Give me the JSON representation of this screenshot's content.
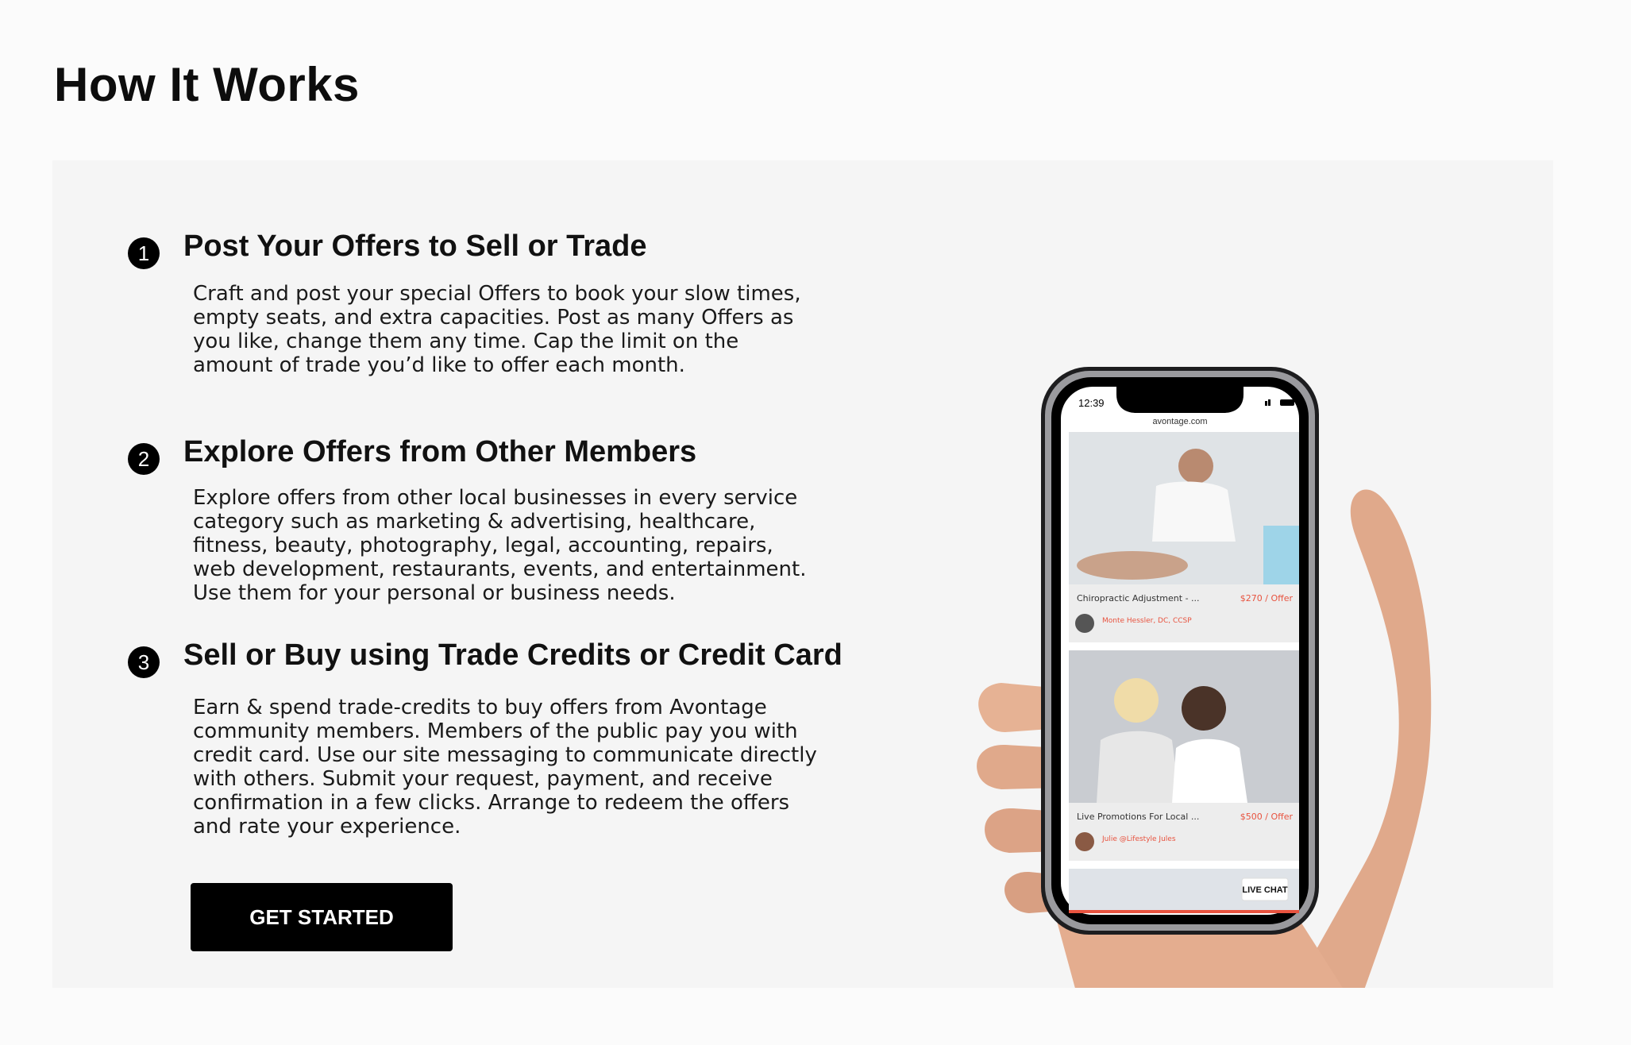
{
  "page": {
    "title": "How It Works"
  },
  "steps": [
    {
      "number": "1",
      "title": "Post Your Offers to Sell or Trade",
      "body": "Craft and post your special Offers to book your slow times, empty seats, and extra capacities. Post as many Offers as you like, change them any time. Cap the limit on the amount of trade you’d like to offer each month."
    },
    {
      "number": "2",
      "title": "Explore Offers from Other Members",
      "body": "Explore offers from other local businesses in every service category such as marketing & advertising, healthcare, fitness, beauty, photography, legal, accounting, repairs, web development, restaurants, events, and entertainment. Use them for your personal or business needs."
    },
    {
      "number": "3",
      "title": "Sell or Buy using Trade Credits or Credit Card",
      "body": "Earn & spend trade-credits to buy offers from Avontage community members. Members of the public pay you with credit card. Use our site messaging to communicate directly with others. Submit your request, payment, and receive confirmation in a few clicks. Arrange to redeem the offers and rate your experience."
    }
  ],
  "cta": {
    "label": "GET STARTED"
  },
  "phone": {
    "time": "12:39",
    "url": "avontage.com",
    "offers": [
      {
        "title": "Chiropractic Adjustment - ...",
        "price": "$270 / Offer",
        "seller": "Monte Hessler, DC, CCSP"
      },
      {
        "title": "Live Promotions For Local ...",
        "price": "$500 / Offer",
        "seller": "Julie @Lifestyle Jules"
      }
    ],
    "chat_label": "LIVE CHAT"
  },
  "colors": {
    "accent_price": "#e8533f",
    "button_bg": "#000000"
  }
}
